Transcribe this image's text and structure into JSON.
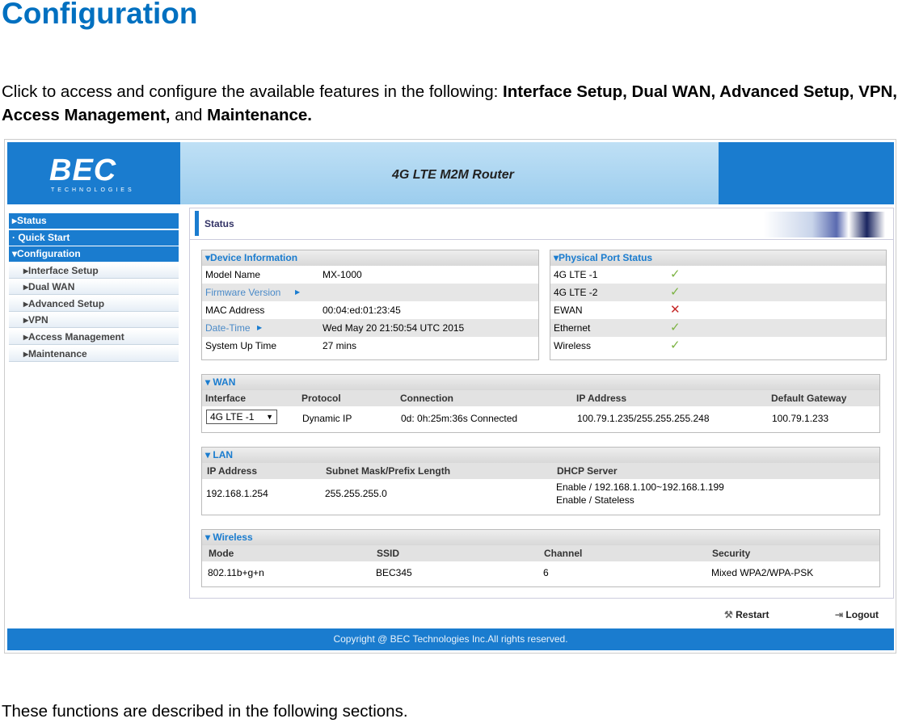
{
  "doc": {
    "title": "Configuration",
    "intro_plain": "Click to access and configure the available features in the following: ",
    "intro_bold": "Interface Setup, Dual WAN, Advanced Setup, VPN, Access Management,",
    "intro_and": " and ",
    "intro_bold2": "Maintenance.",
    "outro": "These functions are described in the following sections."
  },
  "app": {
    "logo": "BEC",
    "logo_sub": "TECHNOLOGIES",
    "product": "4G LTE M2M Router",
    "brand_color": "#1a7ccf",
    "nav": [
      {
        "label": "Status",
        "icon": "triangle-right"
      },
      {
        "label": "Quick Start",
        "icon": "dot"
      },
      {
        "label": "Configuration",
        "icon": "triangle-down"
      }
    ],
    "subnav": [
      "Interface Setup",
      "Dual WAN",
      "Advanced Setup",
      "VPN",
      "Access Management",
      "Maintenance"
    ],
    "page_title": "Status",
    "device": {
      "title": "Device Information",
      "rows": [
        {
          "label": "Model Name",
          "value": "MX-1000"
        },
        {
          "label": "Firmware Version",
          "value": ""
        },
        {
          "label": "MAC Address",
          "value": "00:04:ed:01:23:45"
        },
        {
          "label": "Date-Time",
          "value": "Wed May 20 21:50:54 UTC 2015"
        },
        {
          "label": "System Up Time",
          "value": "27 mins"
        }
      ]
    },
    "ports": {
      "title": "Physical Port Status",
      "rows": [
        {
          "label": "4G LTE -1",
          "status": "up",
          "icon": "✓"
        },
        {
          "label": "4G LTE -2",
          "status": "up",
          "icon": "✓"
        },
        {
          "label": "EWAN",
          "status": "down",
          "icon": "✕"
        },
        {
          "label": "Ethernet",
          "status": "up",
          "icon": "✓"
        },
        {
          "label": "Wireless",
          "status": "up",
          "icon": "✓"
        }
      ]
    },
    "wan": {
      "title": "WAN",
      "headers": [
        "Interface",
        "Protocol",
        "Connection",
        "IP Address",
        "Default Gateway"
      ],
      "interface": "4G LTE -1",
      "protocol": "Dynamic IP",
      "connection": "0d: 0h:25m:36s Connected",
      "ip": "100.79.1.235/255.255.255.248",
      "gateway": "100.79.1.233"
    },
    "lan": {
      "title": "LAN",
      "headers": [
        "IP Address",
        "Subnet Mask/Prefix Length",
        "DHCP Server"
      ],
      "ip": "192.168.1.254",
      "mask": "255.255.255.0",
      "dhcp1": "Enable / 192.168.1.100~192.168.1.199",
      "dhcp2": "Enable / Stateless"
    },
    "wireless": {
      "title": "Wireless",
      "headers": [
        "Mode",
        "SSID",
        "Channel",
        "Security"
      ],
      "mode": "802.11b+g+n",
      "ssid": "BEC345",
      "channel": "6",
      "security": "Mixed WPA2/WPA-PSK"
    },
    "restart": "Restart",
    "logout": "Logout",
    "footer": "Copyright @ BEC Technologies Inc.All rights reserved."
  }
}
